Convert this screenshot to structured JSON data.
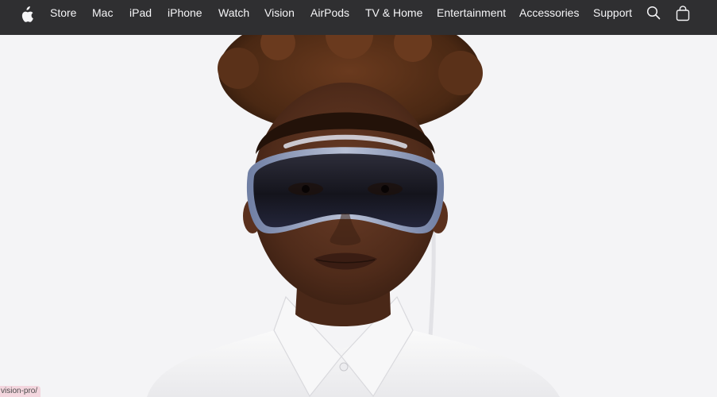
{
  "nav": {
    "logo_icon": "apple-logo-icon",
    "items": [
      "Store",
      "Mac",
      "iPad",
      "iPhone",
      "Watch",
      "Vision",
      "AirPods",
      "TV & Home",
      "Entertainment",
      "Accessories",
      "Support"
    ],
    "search_icon": "search-icon",
    "bag_icon": "shopping-bag-icon"
  },
  "hero": {
    "image": "person-wearing-vision-pro-headset"
  },
  "status_bar": {
    "url": "vision-pro/"
  },
  "colors": {
    "nav_background": "#2f2f31",
    "nav_text": "#f5f5f7",
    "hero_background": "#f4f4f6"
  }
}
